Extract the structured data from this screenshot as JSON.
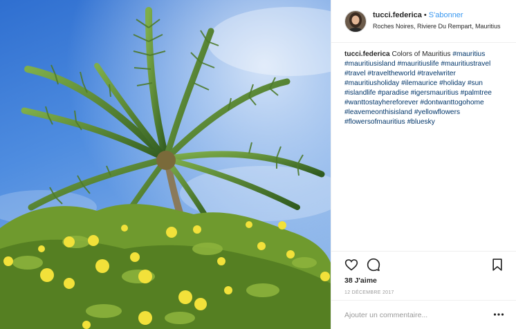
{
  "post": {
    "username": "tucci.federica",
    "separator": "•",
    "follow_label": "S'abonner",
    "location": "Roches Noires, Riviere Du Rempart, Mauritius",
    "photo_icon": "palm-tree-photo",
    "caption": {
      "username": "tucci.federica",
      "text": "Colors of Mauritius",
      "hashtags": [
        "#mauritius",
        "#mauritiusisland",
        "#mauritiuslife",
        "#mauritiustravel",
        "#travel",
        "#traveltheworld",
        "#travelwriter",
        "#mauritiusholiday",
        "#ilemaurice",
        "#holiday",
        "#sun",
        "#islandlife",
        "#paradise",
        "#igersmauritius",
        "#palmtree",
        "#wanttostayhereforever",
        "#dontwanttogohome",
        "#leavemeonthisisland",
        "#yellowflowers",
        "#flowersofmauritius",
        "#bluesky"
      ]
    },
    "likes_label": "38 J'aime",
    "date": "12 DÉCEMBRE 2017",
    "comment_placeholder": "Ajouter un commentaire...",
    "icons": {
      "like": "heart-icon",
      "comment": "comment-icon",
      "save": "bookmark-icon",
      "more": "more-options-icon"
    }
  },
  "colors": {
    "link": "#3897f0",
    "hashtag": "#003569",
    "muted": "#999999",
    "border": "#efefef"
  }
}
